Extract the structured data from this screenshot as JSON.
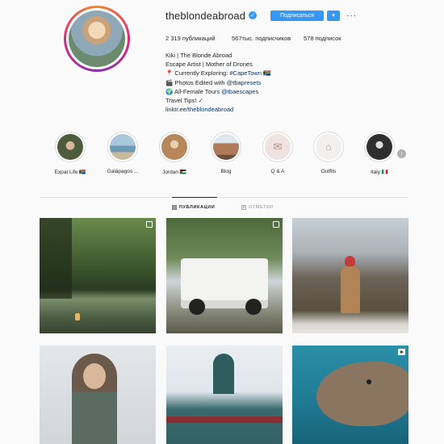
{
  "profile": {
    "username": "theblondeabroad",
    "follow_label": "Подписаться",
    "more_label": "···",
    "stats": {
      "posts": "2 319 публикаций",
      "followers": "567тыс. подписчиков",
      "following": "578 подписок"
    },
    "bio": {
      "name": "Kiki | The Blonde Abroad",
      "line1": "Escape Artist | Mother of Drones",
      "line2_prefix": "📍 Currently Exploring: ",
      "line2_tag": "#CapeTown",
      "line2_suffix": " 🇿🇦",
      "line3_prefix": "🎬 Photos Edited with ",
      "line3_tag": "@tbapresets",
      "line4_prefix": "🌍 All-Female Tours ",
      "line4_tag": "@tbaescapes",
      "line5": "Travel Tips! ✓",
      "link": "linktr.ee/theblondeabroad"
    }
  },
  "highlights": [
    {
      "label": "Expat Life 🇿🇦",
      "color": "#5a6b4a"
    },
    {
      "label": "Galápagos ...",
      "color": "#7fa8c0"
    },
    {
      "label": "Jordan 🇯🇴",
      "color": "#c4996a"
    },
    {
      "label": "Blog",
      "color": "#b58f6f"
    },
    {
      "label": "Q & A",
      "color": "#efe3df"
    },
    {
      "label": "Outfits",
      "color": "#f2efee"
    },
    {
      "label": "Italy 🇮🇹",
      "color": "#3d3d3d"
    }
  ],
  "tabs": {
    "posts": "ПУБЛИКАЦИИ",
    "tagged": "ОТМЕТКИ"
  },
  "posts": [
    {
      "type": "multi",
      "desc": "lake-canoe"
    },
    {
      "type": "multi",
      "desc": "white-land-rover"
    },
    {
      "type": "none",
      "desc": "central-park-winter"
    },
    {
      "type": "none",
      "desc": "snow-rocks"
    },
    {
      "type": "none",
      "desc": "snowy-shop"
    },
    {
      "type": "video",
      "desc": "sea-lion"
    }
  ]
}
